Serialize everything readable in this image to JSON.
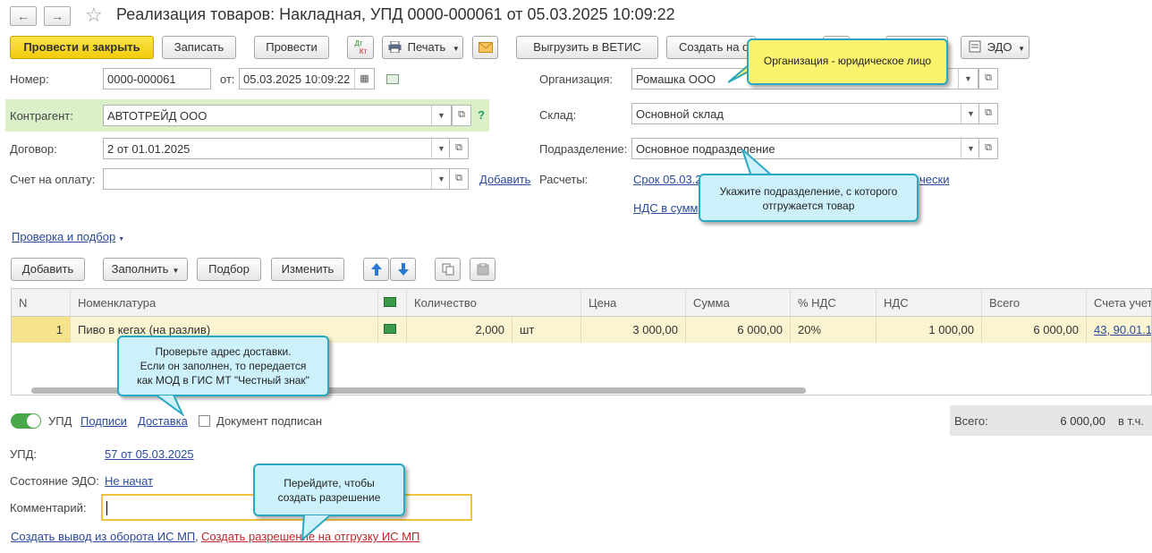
{
  "window": {
    "title": "Реализация товаров: Накладная, УПД 0000-000061 от 05.03.2025 10:09:22",
    "back_glyph": "←",
    "forward_glyph": "→",
    "star_glyph": "☆"
  },
  "toolbar": {
    "post_close": "Провести и закрыть",
    "save": "Записать",
    "post": "Провести",
    "dtkt_top": "Дт",
    "dtkt_bottom": "Кт",
    "print": "Печать",
    "vetis": "Выгрузить в ВЕТИС",
    "create_on_basis": "Создать на о",
    "edo": "ЭДО"
  },
  "form": {
    "number_label": "Номер:",
    "number_value": "0000-000061",
    "date_label": "от:",
    "date_value": "05.03.2025 10:09:22",
    "org_label": "Организация:",
    "org_value": "Ромашка ООО",
    "counterparty_label": "Контрагент:",
    "counterparty_value": "АВТОТРЕЙД ООО",
    "help_glyph": "?",
    "warehouse_label": "Склад:",
    "warehouse_value": "Основной склад",
    "contract_label": "Договор:",
    "contract_value": "2 от 01.01.2025",
    "division_label": "Подразделение:",
    "division_value": "Основное подразделение",
    "invoice_label": "Счет на оплату:",
    "invoice_value": "",
    "add_link": "Добавить",
    "settlements_label": "Расчеты:",
    "settlements_link1": "Срок 05.03.2",
    "settlements_link1_tail": "чески",
    "settlements_link2": "НДС в сумм"
  },
  "check_link": "Проверка и подбор",
  "table_toolbar": {
    "add": "Добавить",
    "fill": "Заполнить",
    "select": "Подбор",
    "edit": "Изменить"
  },
  "table": {
    "columns": [
      "N",
      "Номенклатура",
      "",
      "Количество",
      "",
      "Цена",
      "Сумма",
      "% НДС",
      "НДС",
      "Всего",
      "Счета учет"
    ],
    "rows": [
      {
        "n": "1",
        "item": "Пиво в кегах (на разлив)",
        "qty": "2,000",
        "unit": "шт",
        "price": "3 000,00",
        "sum": "6 000,00",
        "vat_rate": "20%",
        "vat": "1 000,00",
        "total": "6 000,00",
        "accounts": "43, 90.01.1"
      }
    ]
  },
  "footer": {
    "upd_toggle_label": "УПД",
    "signatures_link": "Подписи",
    "delivery_link": "Доставка",
    "signed_label": "Документ подписан",
    "total_label": "Всего:",
    "total_value": "6 000,00",
    "vat_label": "в т.ч.",
    "upd_label": "УПД:",
    "upd_link": "57 от 05.03.2025",
    "edo_state_label": "Состояние ЭДО:",
    "edo_state_link": "Не начат",
    "comment_label": "Комментарий:",
    "comment_value": "",
    "withdrawal_link": "Создать вывод из оборота ИС МП",
    "separator": ",",
    "permission_link": "Создать разрешение на отгрузку ИС МП"
  },
  "tips": {
    "org": "Организация - юридическое лицо",
    "division_line1": "Укажите подразделение, с которого",
    "division_line2": "отгружается товар",
    "delivery_line1": "Проверьте адрес доставки.",
    "delivery_line2": "Если он заполнен, то передается",
    "delivery_line3": "как МОД в ГИС МТ \"Честный знак\"",
    "permission_line1": "Перейдите, чтобы",
    "permission_line2": "создать разрешение"
  },
  "colors": {
    "primary_button": "#f2cb0a",
    "link": "#2a4a9e",
    "red_link": "#c0262b",
    "selected_row": "#faf4d0",
    "counterparty_bg": "#d9f0c8",
    "tooltip": "#cdf1fb",
    "tooltip_yellow": "#fbf36e"
  }
}
